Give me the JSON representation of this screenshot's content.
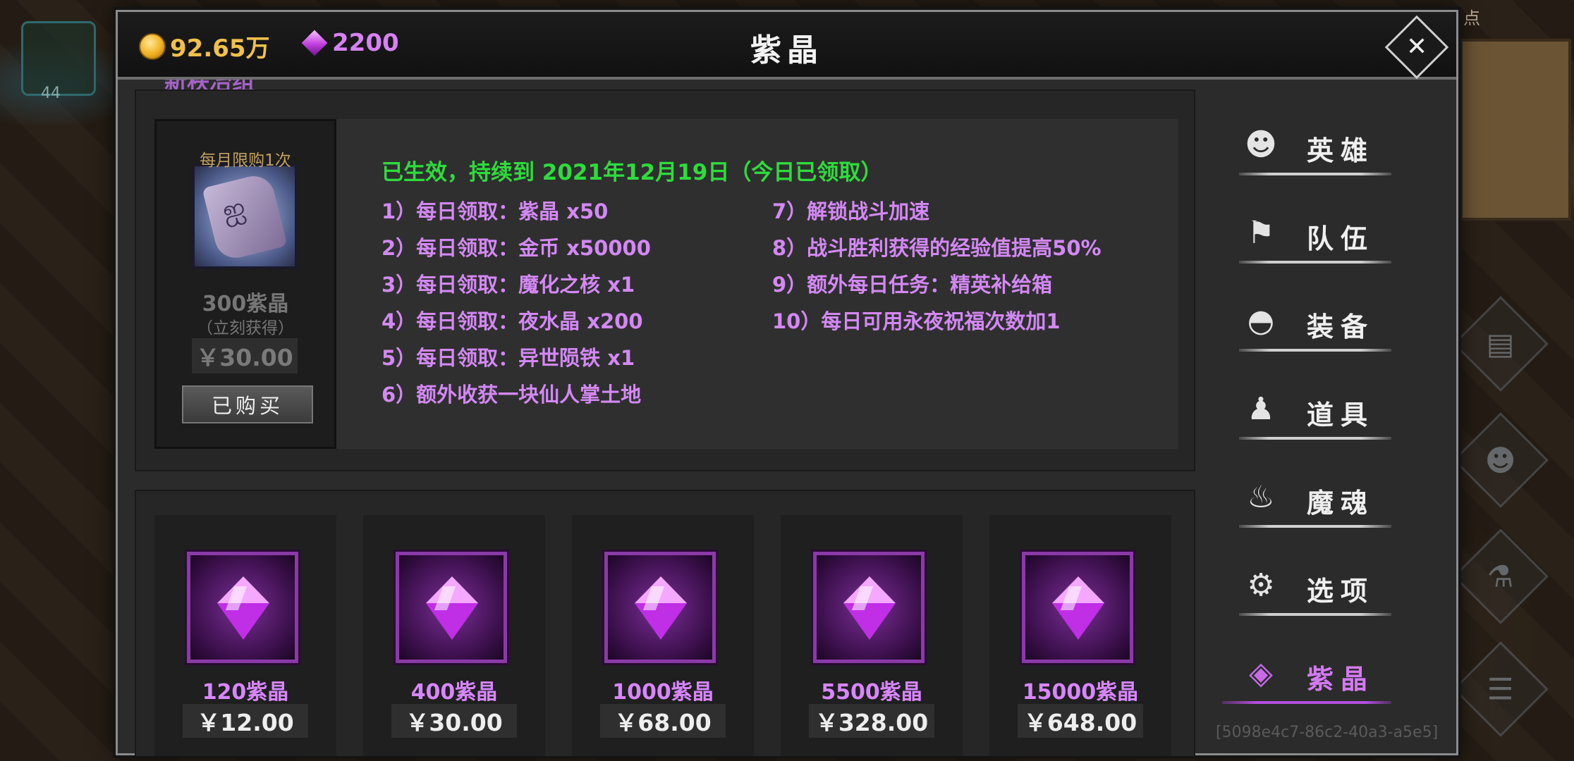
{
  "background": {
    "slot_count": "44",
    "minimap_label": "点"
  },
  "header": {
    "gold": "92.65万",
    "gems": "2200",
    "title": "紫晶",
    "close_icon": "close-icon"
  },
  "monthly_card": {
    "cutoff_heading": "新秩冶组",
    "limit_badge": "每月限购1次",
    "amount": "300紫晶",
    "amount_note": "（立刻获得）",
    "price": "￥30.00",
    "button_label": "已购买",
    "status": "已生效，持续到 2021年12月19日（今日已领取）",
    "perks_left": [
      "1）每日领取：紫晶 x50",
      "2）每日领取：金币 x50000",
      "3）每日领取：魔化之核 x1",
      "4）每日领取：夜水晶 x200",
      "5）每日领取：异世陨铁 x1",
      "6）额外收获一块仙人掌土地"
    ],
    "perks_right": [
      "7）解锁战斗加速",
      "8）战斗胜利获得的经验值提高50%",
      "9）额外每日任务：精英补给箱",
      "10）每日可用永夜祝福次数加1"
    ]
  },
  "packs": [
    {
      "amount": "120紫晶",
      "price": "￥12.00"
    },
    {
      "amount": "400紫晶",
      "price": "￥30.00"
    },
    {
      "amount": "1000紫晶",
      "price": "￥68.00"
    },
    {
      "amount": "5500紫晶",
      "price": "￥328.00"
    },
    {
      "amount": "15000紫晶",
      "price": "￥648.00"
    }
  ],
  "sidebar": {
    "items": [
      {
        "label": "英雄",
        "icon": "heroes-icon"
      },
      {
        "label": "队伍",
        "icon": "flag-icon"
      },
      {
        "label": "装备",
        "icon": "helmet-icon"
      },
      {
        "label": "道具",
        "icon": "bag-icon"
      },
      {
        "label": "魔魂",
        "icon": "flame-icon"
      },
      {
        "label": "选项",
        "icon": "gear-icon"
      },
      {
        "label": "紫晶",
        "icon": "crystal-icon",
        "active": true
      }
    ]
  },
  "session_id": "[5098e4c7-86c2-40a3-a5e5]",
  "colors": {
    "accent_purple": "#d37af2",
    "status_green": "#2edc3c",
    "gold": "#f1c04a"
  }
}
